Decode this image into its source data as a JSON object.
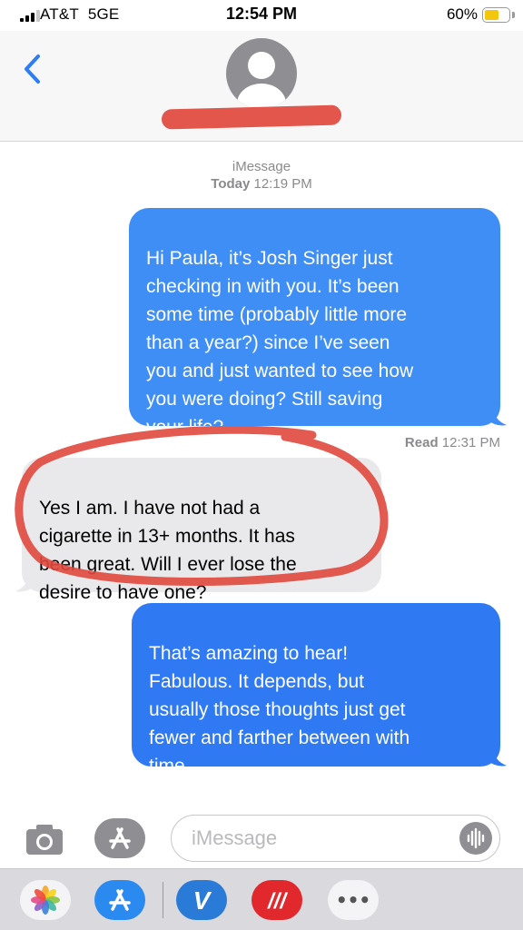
{
  "status_bar": {
    "carrier": "AT&T",
    "network": "5GE",
    "time": "12:54 PM",
    "battery_percent": "60%",
    "battery_level": 0.6
  },
  "header": {
    "back_icon": "chevron-left-icon",
    "avatar_icon": "person-silhouette-icon"
  },
  "thread": {
    "service": "iMessage",
    "timestamp_day": "Today",
    "timestamp_time": "12:19 PM",
    "messages": [
      {
        "direction": "outgoing",
        "text": "Hi Paula, it’s Josh Singer just\nchecking in with you. It’s been\nsome time (probably little more\nthan a year?) since I’ve seen\nyou and just wanted to see how\nyou were doing? Still saving\nyour life?"
      },
      {
        "direction": "incoming",
        "text": "Yes I am. I have not had a\ncigarette in 13+ months. It has\nbeen great. Will I ever lose the\ndesire to have one?"
      },
      {
        "direction": "outgoing",
        "text": "That’s amazing to hear!\nFabulous. It depends, but\nusually those thoughts just get\nfewer and farther between with\ntime."
      }
    ],
    "read_receipt_label": "Read",
    "read_receipt_time": "12:31 PM"
  },
  "compose": {
    "placeholder": "iMessage"
  },
  "colors": {
    "outgoing_bubble": "#3f8ef5",
    "incoming_bubble": "#e9e9eb",
    "annotation_red": "#e0483d"
  },
  "app_drawer": {
    "apps": [
      "photos-icon",
      "app-store-icon",
      "venmo-icon",
      "stripes-app-icon",
      "more-icon"
    ],
    "venmo_glyph": "V",
    "stripes_glyph": "///",
    "more_glyph": "•••"
  }
}
